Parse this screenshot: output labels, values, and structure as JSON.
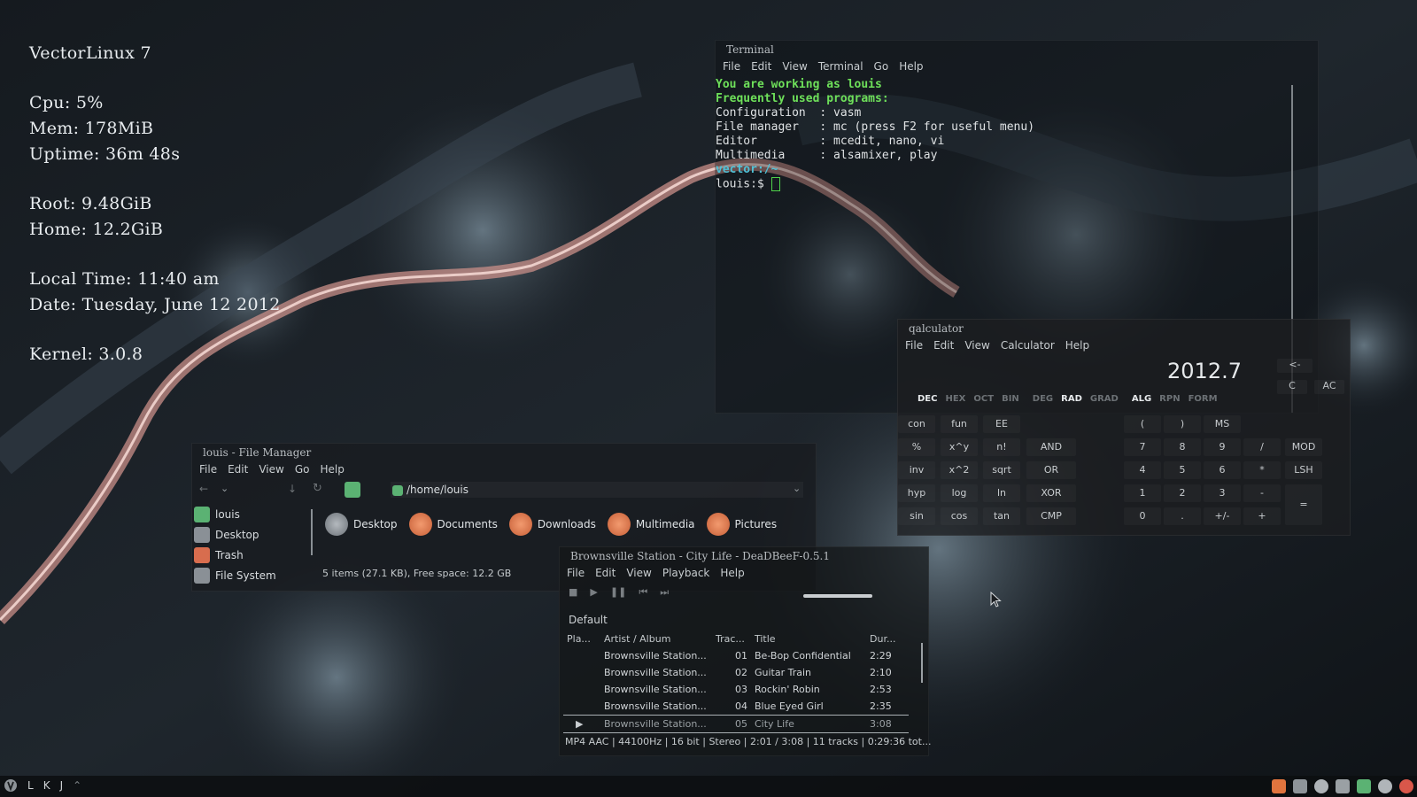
{
  "conky": {
    "os": "VectorLinux 7",
    "cpu": "Cpu: 5%",
    "mem": "Mem: 178MiB",
    "uptime": "Uptime: 36m 48s",
    "root": "Root: 9.48GiB",
    "home": "Home: 12.2GiB",
    "time": "Local Time: 11:40 am",
    "date": "Date: Tuesday, June 12 2012",
    "kernel": "Kernel: 3.0.8"
  },
  "terminal": {
    "title": "Terminal",
    "menu": [
      "File",
      "Edit",
      "View",
      "Terminal",
      "Go",
      "Help"
    ],
    "lines": {
      "l1": "You are working as louis",
      "l2": "Frequently used programs:",
      "l3": "Configuration  : vasm",
      "l4": "File manager   : mc (press F2 for useful menu)",
      "l5": "Editor         : mcedit, nano, vi",
      "l6": "Multimedia     : alsamixer, play",
      "l7": "vector:/~",
      "l8": "louis:$ "
    }
  },
  "calculator": {
    "title": "qalculator",
    "menu": [
      "File",
      "Edit",
      "View",
      "Calculator",
      "Help"
    ],
    "display": "2012.7",
    "backspace": "<-",
    "clear": "C",
    "allclear": "AC",
    "modes": [
      "DEC",
      "HEX",
      "OCT",
      "BIN",
      "DEG",
      "RAD",
      "GRAD",
      "ALG",
      "RPN",
      "FORM"
    ],
    "keys": {
      "con": "con",
      "fun": "fun",
      "ee": "EE",
      "lp": "(",
      "rp": ")",
      "ms": "MS",
      "pct": "%",
      "xpy": "x^y",
      "fact": "n!",
      "and": "AND",
      "k7": "7",
      "k8": "8",
      "k9": "9",
      "div": "/",
      "mod": "MOD",
      "inv": "inv",
      "x2": "x^2",
      "sqrt": "sqrt",
      "or": "OR",
      "k4": "4",
      "k5": "5",
      "k6": "6",
      "mul": "*",
      "lsh": "LSH",
      "hyp": "hyp",
      "log": "log",
      "ln": "ln",
      "xor": "XOR",
      "k1": "1",
      "k2": "2",
      "k3": "3",
      "sub": "-",
      "eq": "=",
      "sin": "sin",
      "cos": "cos",
      "tan": "tan",
      "cmp": "CMP",
      "k0": "0",
      "dot": ".",
      "pm": "+/-",
      "add": "+"
    }
  },
  "filemanager": {
    "title": "louis - File Manager",
    "menu": [
      "File",
      "Edit",
      "View",
      "Go",
      "Help"
    ],
    "path": "/home/louis",
    "sidebar": [
      "louis",
      "Desktop",
      "Trash",
      "File System"
    ],
    "files": [
      "Desktop",
      "Documents",
      "Downloads",
      "Multimedia",
      "Pictures"
    ],
    "status": "5 items (27.1 KB), Free space: 12.2 GB"
  },
  "deadbeef": {
    "title": "Brownsville Station - City Life - DeaDBeeF-0.5.1",
    "menu": [
      "File",
      "Edit",
      "View",
      "Playback",
      "Help"
    ],
    "playlist_tab": "Default",
    "columns": [
      "Pla...",
      "Artist / Album",
      "Trac...",
      "Title",
      "Dur..."
    ],
    "rows": [
      {
        "artist": "Brownsville Station...",
        "track": "01",
        "title": "Be-Bop Confidential",
        "dur": "2:29"
      },
      {
        "artist": "Brownsville Station...",
        "track": "02",
        "title": "Guitar Train",
        "dur": "2:10"
      },
      {
        "artist": "Brownsville Station...",
        "track": "03",
        "title": "Rockin' Robin",
        "dur": "2:53"
      },
      {
        "artist": "Brownsville Station...",
        "track": "04",
        "title": "Blue Eyed Girl",
        "dur": "2:35"
      },
      {
        "artist": "Brownsville Station...",
        "track": "05",
        "title": "City Life",
        "dur": "3:08"
      }
    ],
    "status": "MP4 AAC | 44100Hz | 16 bit | Stereo | 2:01 / 3:08 | 11 tracks | 0:29:36 tot..."
  },
  "taskbar": {
    "items": [
      "L",
      "K",
      "J"
    ]
  },
  "colors": {
    "terminal_green": "#6ee05a",
    "terminal_cyan": "#4fc1d6",
    "folder_orange": "#d86d4e",
    "home_green": "#5bb273"
  }
}
